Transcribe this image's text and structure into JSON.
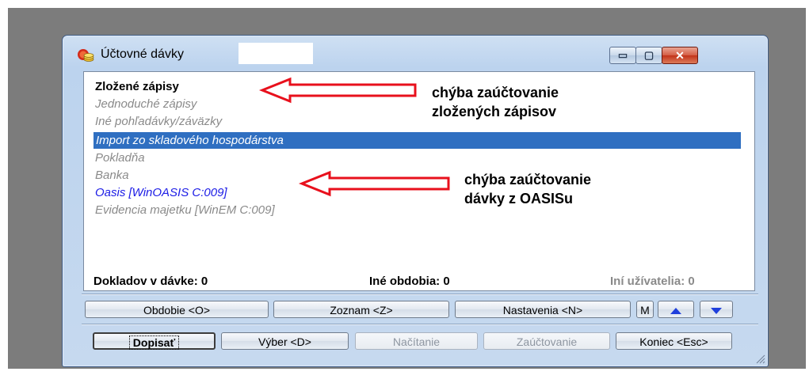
{
  "window": {
    "title": "Účtovné dávky",
    "minimize_glyph": "▭",
    "maximize_glyph": "▢",
    "close_glyph": "✕"
  },
  "list": [
    {
      "label": "Zložené zápisy",
      "style": "bold"
    },
    {
      "label": "Jednoduché zápisy",
      "style": "gray"
    },
    {
      "label": "Iné pohľadávky/záväzky",
      "style": "gray"
    },
    {
      "label": "Import zo skladového hospodárstva",
      "style": "selected"
    },
    {
      "label": "Pokladňa",
      "style": "gray"
    },
    {
      "label": "Banka",
      "style": "gray"
    },
    {
      "label": "Oasis [WinOASIS C:009]",
      "style": "blue"
    },
    {
      "label": "Evidencia majetku [WinEM C:009]",
      "style": "gray"
    }
  ],
  "annotations": {
    "first": [
      "chýba zaúčtovanie",
      "zložených zápisov"
    ],
    "second": [
      "chýba zaúčtovanie",
      "dávky z OASISu"
    ],
    "arrow_color": "#e8101c"
  },
  "status": {
    "documents": "Dokladov v dávke: 0",
    "other_periods": "Iné obdobia: 0",
    "other_users": "Iní užívatelia: 0"
  },
  "toolbar_row1": {
    "period": "Obdobie <O>",
    "list": "Zoznam <Z>",
    "settings": "Nastavenia <N>",
    "m": "M"
  },
  "toolbar_row2": {
    "append": "Dopisať",
    "select": "Výber <D>",
    "load": "Načítanie",
    "post": "Zaúčtovanie",
    "exit": "Koniec <Esc>"
  },
  "icons": {
    "app": "coins-icon",
    "up": "arrow-up-icon",
    "down": "arrow-down-icon",
    "grip": "resize-grip-icon"
  },
  "colors": {
    "selection": "#2f6fc1",
    "link_blue": "#1c1ce6",
    "disabled_gray": "#8a8a8a"
  }
}
